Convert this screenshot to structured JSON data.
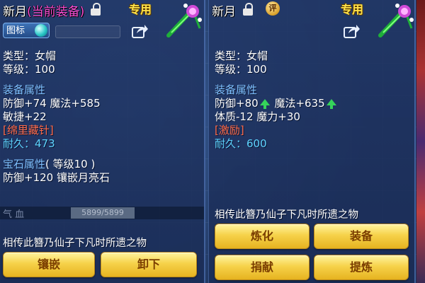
{
  "left_panel": {
    "name": "新月",
    "equipped_tag": "(当前装备)",
    "exclusive": "专用",
    "tujian": "图标",
    "type_line": "类型：女帽",
    "level_line": "等级：100",
    "attr_title": "装备属性",
    "attr_line1": "防御+74 魔法+585",
    "attr_line2": "敏捷+22",
    "special": "[绵里藏针]",
    "durability_label": "耐久：",
    "durability_value": "473",
    "gem_title": "宝石属性",
    "gem_level": "( 等级10 )",
    "gem_line": "防御+120 镶嵌月亮石",
    "hp_label": "气 血",
    "hp_value": "5899/5899",
    "desc": "相传此簪乃仙子下凡时所遗之物",
    "btn_inlay": "镶嵌",
    "btn_unequip": "卸下"
  },
  "right_panel": {
    "name": "新月",
    "exclusive": "专用",
    "badge": "评",
    "type_line": "类型：女帽",
    "level_line": "等级：100",
    "attr_title": "装备属性",
    "attr_def": "防御+80",
    "attr_magic": "魔法+635",
    "attr_line2": "体质-12 魔力+30",
    "special": "[激励]",
    "durability_label": "耐久：",
    "durability_value": "600",
    "desc": "相传此簪乃仙子下凡时所遗之物",
    "btn_refine": "炼化",
    "btn_equip": "装备",
    "btn_donate": "捐献",
    "btn_extract": "提炼"
  },
  "colors": {
    "equipped": "#ff4fd8",
    "section": "#7fc0ff",
    "special": "#ff6b4a",
    "durability": "#5fd4ff",
    "exclusive": "#ffe34a",
    "arrow_up": "#35d35a",
    "button": "#f6d24a"
  }
}
